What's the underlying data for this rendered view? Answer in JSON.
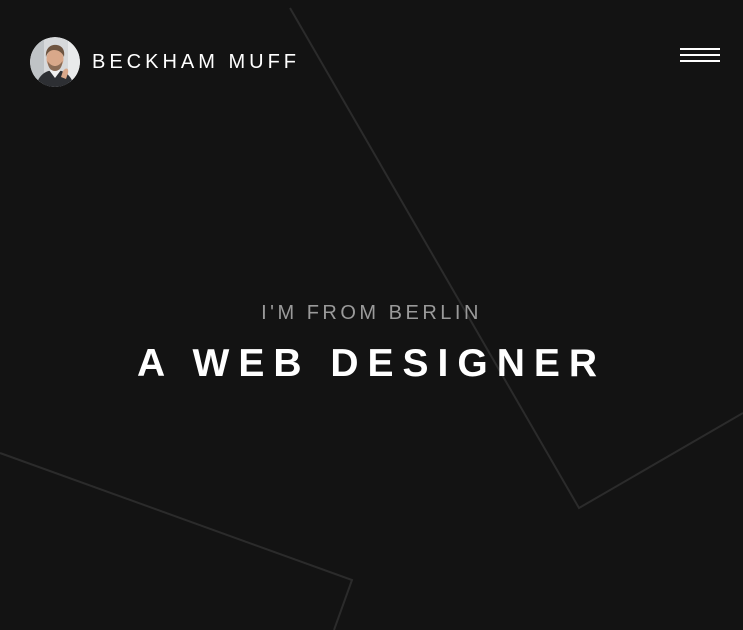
{
  "header": {
    "brand_name": "BECKHAM MUFF",
    "avatar_alt": "Beckham Muff avatar",
    "menu_icon": "hamburger-menu-icon"
  },
  "hero": {
    "subtitle": "I'M FROM BERLIN",
    "title": "A WEB DESIGNER"
  },
  "colors": {
    "background": "#131313",
    "line": "#2b2b2b",
    "text_primary": "#ffffff",
    "text_muted": "#9a9a9a"
  }
}
